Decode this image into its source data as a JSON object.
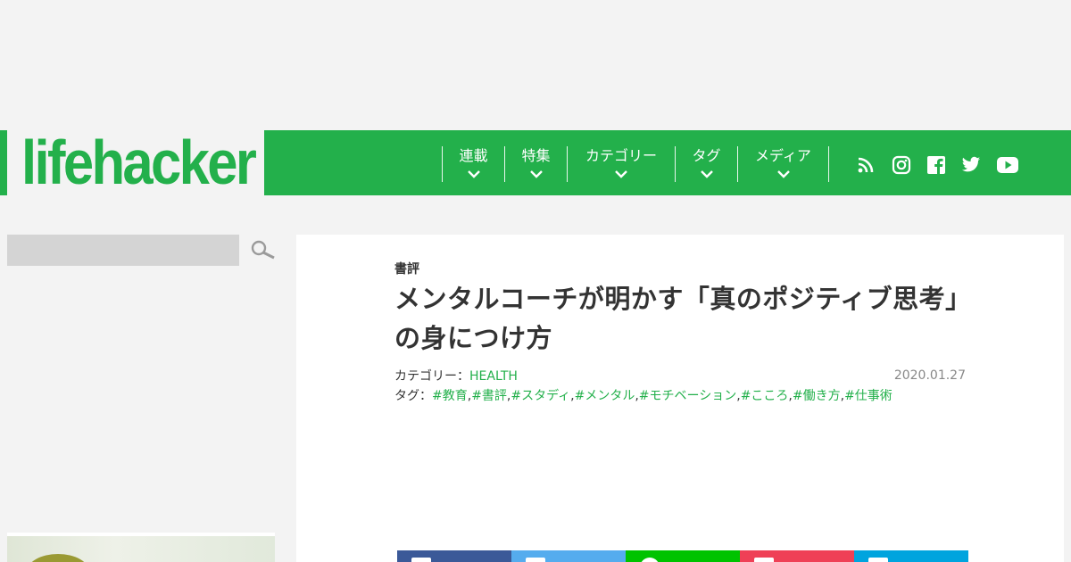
{
  "logo": {
    "text": "lifehacker"
  },
  "nav": {
    "items": [
      {
        "label": "連載"
      },
      {
        "label": "特集"
      },
      {
        "label": "カテゴリー"
      },
      {
        "label": "タグ"
      },
      {
        "label": "メディア"
      }
    ],
    "social_icons": [
      "rss-icon",
      "instagram-icon",
      "facebook-icon",
      "twitter-icon",
      "youtube-icon"
    ]
  },
  "search": {
    "placeholder": "",
    "icon": "search-icon"
  },
  "article": {
    "category_label": "書評",
    "title": "メンタルコーチが明かす「真のポジティブ思考」の身につけ方",
    "category_prefix": "カテゴリー：",
    "category_value": "HEALTH",
    "date": "2020.01.27",
    "tags_prefix": "タグ：",
    "tags": [
      "#教育",
      "#書評",
      "#スタディ",
      "#メンタル",
      "#モチベーション",
      "#こころ",
      "#働き方",
      "#仕事術"
    ]
  },
  "share": {
    "buttons": [
      {
        "name": "facebook",
        "color": "#3b5998"
      },
      {
        "name": "twitter",
        "color": "#55acee"
      },
      {
        "name": "line",
        "color": "#00c300"
      },
      {
        "name": "pocket",
        "color": "#ef4056"
      },
      {
        "name": "hatena",
        "color": "#00a4de"
      }
    ]
  },
  "colors": {
    "brand": "#23b04b",
    "background": "#f3f3f3",
    "search_bg": "#d4d4d4"
  }
}
